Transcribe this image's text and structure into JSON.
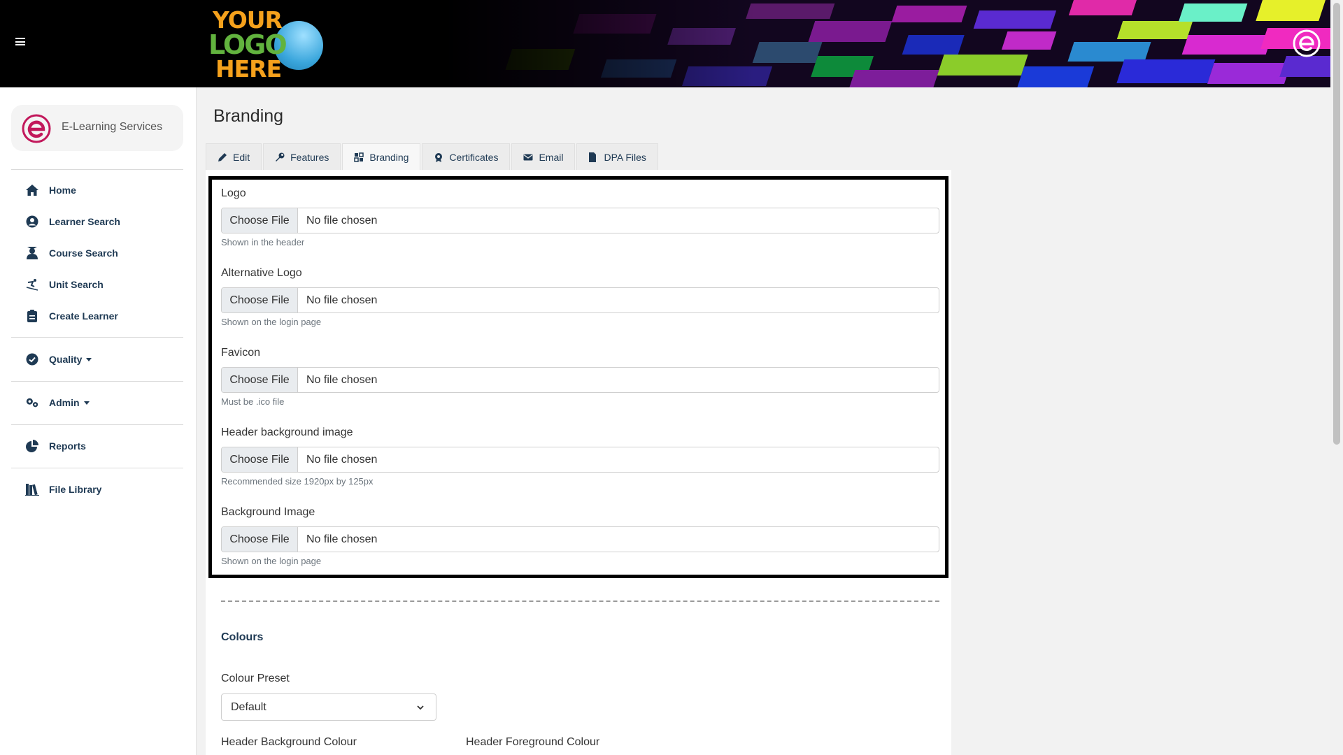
{
  "header": {
    "menu_icon": "hamburger-icon",
    "logo_lines": [
      "YOUR",
      "LOGO",
      "HERE"
    ],
    "brand_icon": "e-learning-logo-icon"
  },
  "sidebar": {
    "brand_name": "E-Learning Services",
    "items": [
      {
        "label": "Home",
        "icon": "home-icon"
      },
      {
        "label": "Learner Search",
        "icon": "user-circle-icon"
      },
      {
        "label": "Course Search",
        "icon": "graduate-icon"
      },
      {
        "label": "Unit Search",
        "icon": "skier-icon"
      },
      {
        "label": "Create Learner",
        "icon": "clipboard-icon"
      },
      {
        "label": "Quality",
        "icon": "check-circle-icon"
      },
      {
        "label": "Admin",
        "icon": "cogs-icon"
      },
      {
        "label": "Reports",
        "icon": "pie-chart-icon"
      },
      {
        "label": "File Library",
        "icon": "books-icon"
      }
    ]
  },
  "main": {
    "title": "Branding",
    "tabs": [
      {
        "label": "Edit",
        "icon": "pencil-icon"
      },
      {
        "label": "Features",
        "icon": "wrench-icon"
      },
      {
        "label": "Branding",
        "icon": "brush-icon"
      },
      {
        "label": "Certificates",
        "icon": "certificate-icon"
      },
      {
        "label": "Email",
        "icon": "envelope-icon"
      },
      {
        "label": "DPA Files",
        "icon": "file-icon"
      }
    ],
    "active_tab": "Branding",
    "fields": [
      {
        "label": "Logo",
        "button": "Choose File",
        "status": "No file chosen",
        "help": "Shown in the header"
      },
      {
        "label": "Alternative Logo",
        "button": "Choose File",
        "status": "No file chosen",
        "help": "Shown on the login page"
      },
      {
        "label": "Favicon",
        "button": "Choose File",
        "status": "No file chosen",
        "help": "Must be .ico file"
      },
      {
        "label": "Header background image",
        "button": "Choose File",
        "status": "No file chosen",
        "help": "Recommended size 1920px by 125px"
      },
      {
        "label": "Background Image",
        "button": "Choose File",
        "status": "No file chosen",
        "help": "Shown on the login page"
      }
    ],
    "colours": {
      "title": "Colours",
      "preset_label": "Colour Preset",
      "preset_value": "Default",
      "header_bg_label": "Header Background Colour",
      "header_fg_label": "Header Foreground Colour"
    }
  },
  "colors": {
    "nav_text": "#1f3a54",
    "brand_magenta": "#c2185b",
    "highlight_border": "#000000"
  }
}
